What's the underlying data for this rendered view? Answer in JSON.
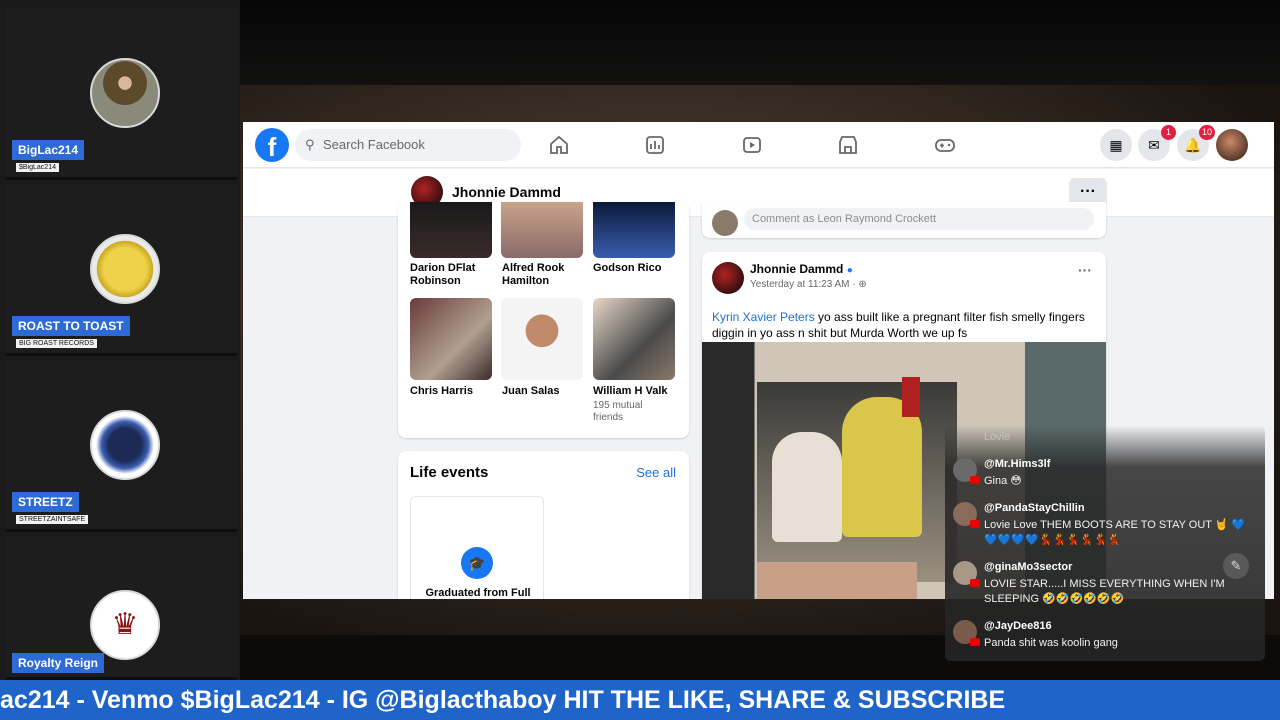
{
  "sidebar": {
    "participants": [
      {
        "name": "BigLac214",
        "handle": "$BigLac214"
      },
      {
        "name": "ROAST TO TOAST",
        "handle": "BIG ROAST RECORDS"
      },
      {
        "name": "STREETZ",
        "handle": "STREETZAINTSAFE"
      },
      {
        "name": "Royalty Reign",
        "handle": ""
      }
    ]
  },
  "facebook": {
    "search_placeholder": "Search Facebook",
    "messenger_badge": "1",
    "notifications_badge": "10",
    "profile_name": "Jhonnie Dammd",
    "more_label": "···",
    "friends": [
      {
        "name": "Darion DFlat Robinson",
        "sub": ""
      },
      {
        "name": "Alfred Rook Hamilton",
        "sub": ""
      },
      {
        "name": "Godson Rico",
        "sub": ""
      },
      {
        "name": "Chris Harris",
        "sub": ""
      },
      {
        "name": "Juan Salas",
        "sub": ""
      },
      {
        "name": "William H Valk",
        "sub": "195 mutual friends"
      }
    ],
    "life_events": {
      "title": "Life events",
      "see_all": "See all",
      "event_label": "Graduated from Full"
    },
    "comment_placeholder": "Comment as Leon Raymond Crockett",
    "post": {
      "author": "Jhonnie Dammd",
      "time": "Yesterday at 11:23 AM · ",
      "tagged": "Kyrin Xavier Peters",
      "text": " yo ass built like a pregnant filter fish smelly fingers diggin in yo ass n shit but Murda Worth we up fs",
      "more_label": "···"
    }
  },
  "chat": {
    "fading_label": "Lovie",
    "messages": [
      {
        "user": "@Mr.Hims3lf",
        "text": "Gina 😳"
      },
      {
        "user": "@PandaStayChillin",
        "text": "Lovie Love THEM BOOTS ARE TO STAY OUT 🤘 💙💙💙💙💙💃💃💃💃💃💃"
      },
      {
        "user": "@ginaMo3sector",
        "text": "LOVIE STAR.....I MISS EVERYTHING WHEN I'M SLEEPING 🤣🤣🤣🤣🤣🤣"
      },
      {
        "user": "@JayDee816",
        "text": "Panda shit was koolin gang"
      }
    ]
  },
  "ticker": {
    "text": "ac214 - Venmo $BigLac214 - IG @Biglacthaboy HIT THE LIKE, SHARE & SUBSCRIBE"
  },
  "colors": {
    "fb_blue": "#1877f2",
    "name_tag_blue": "#2e6ad6",
    "ticker_blue": "#1f65c9",
    "badge_red": "#e41e3f"
  }
}
